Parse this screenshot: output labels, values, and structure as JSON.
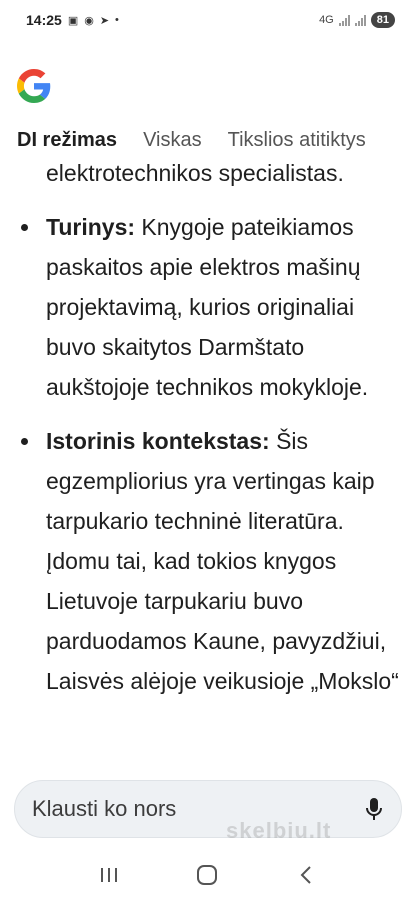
{
  "status_bar": {
    "time": "14:25",
    "notification_icons": [
      "gallery-icon",
      "messenger-icon",
      "telegram-icon",
      "dot-icon"
    ],
    "network": "4G",
    "battery": "81"
  },
  "tabs": [
    {
      "label": "DI režimas",
      "active": true
    },
    {
      "label": "Viskas",
      "active": false
    },
    {
      "label": "Tikslios atitiktys",
      "active": false
    }
  ],
  "content": {
    "lead": "elektrotechnikos specialistas.",
    "bullets": [
      {
        "title": "Turinys:",
        "text": " Knygoje pateikiamos paskaitos apie elektros mašinų projektavimą, kurios originaliai buvo skaitytos Darmštato aukštojoje technikos mokykloje."
      },
      {
        "title": "Istorinis kontekstas:",
        "text": " Šis egzempliorius yra vertingas kaip tarpukario techninė literatūra. Įdomu tai, kad tokios knygos Lietuvoje tarpukariu buvo parduodamos Kaune, pavyzdžiui, Laisvės alėjoje veikusioje „Mokslo“"
      }
    ]
  },
  "search": {
    "placeholder": "Klausti ko nors",
    "mic_icon": "microphone-icon"
  },
  "watermark": "skelbiu.lt",
  "nav_bar": {
    "icons": [
      "recent-apps-icon",
      "home-icon",
      "back-icon"
    ]
  },
  "colors": {
    "google_blue": "#4285F4",
    "google_red": "#EA4335",
    "google_yellow": "#FBBC05",
    "google_green": "#34A853",
    "search_bg": "#eef1f4"
  }
}
